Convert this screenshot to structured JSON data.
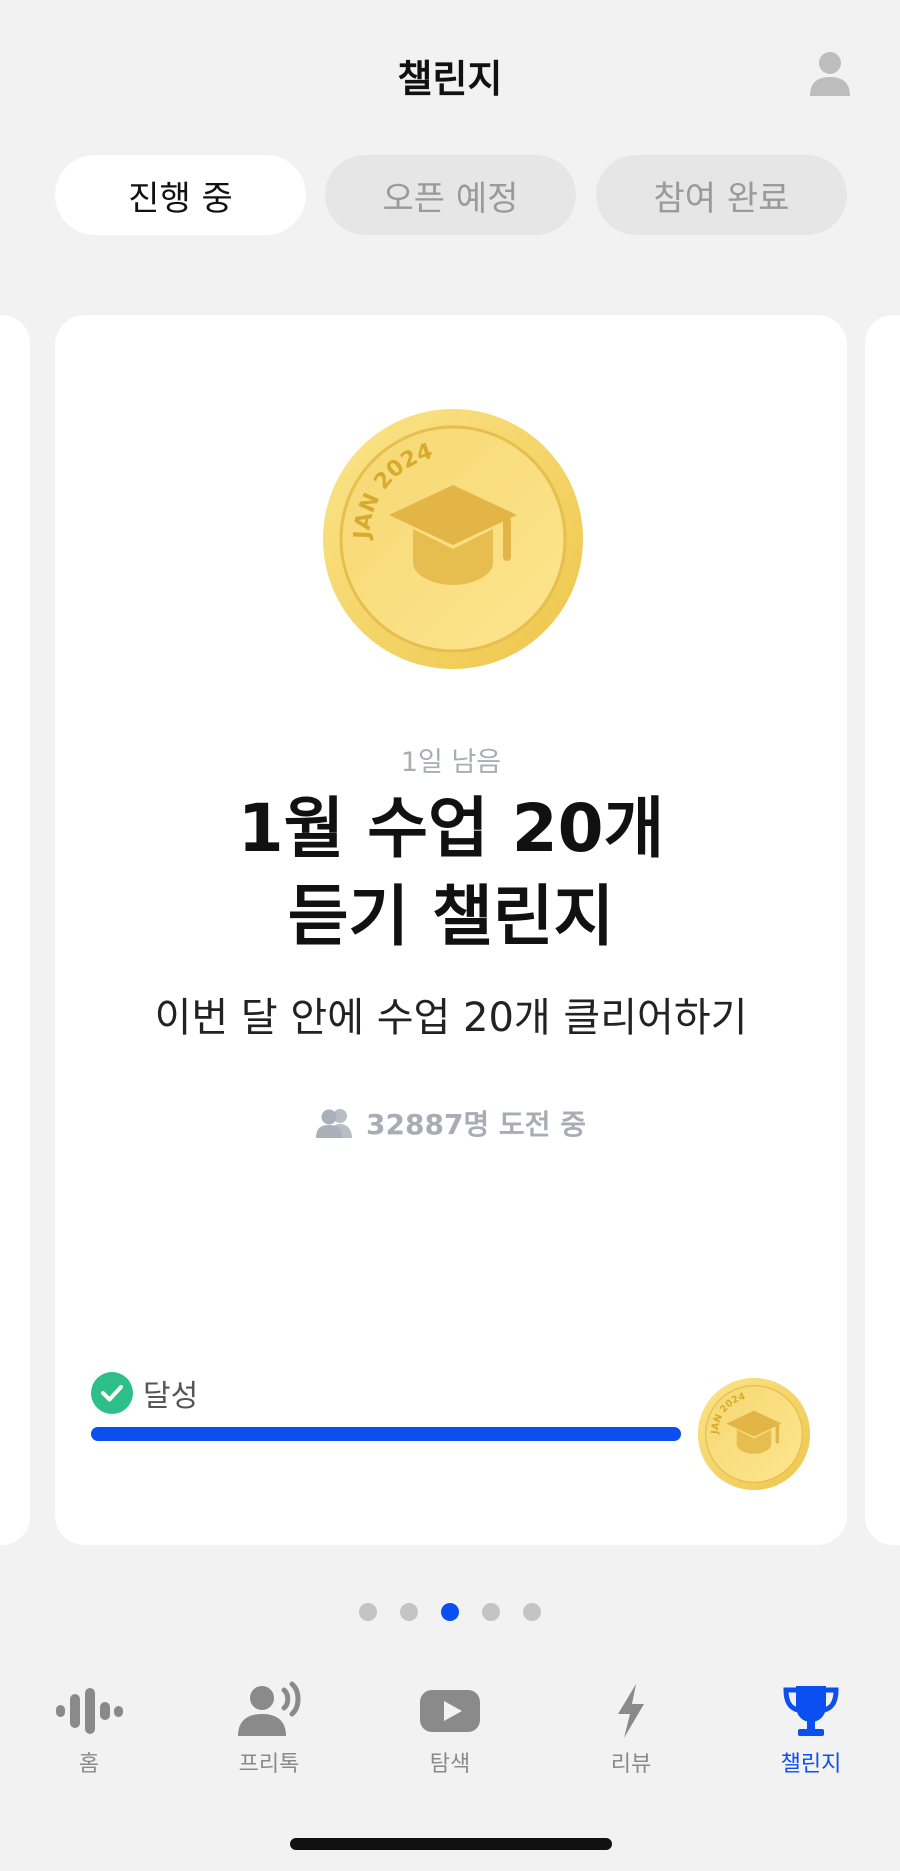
{
  "header": {
    "title": "챌린지",
    "profile_icon": "person-icon"
  },
  "tabs": [
    {
      "label": "진행 중",
      "active": true
    },
    {
      "label": "오픈 예정",
      "active": false
    },
    {
      "label": "참여 완료",
      "active": false
    }
  ],
  "card": {
    "medal_text": "JAN 2024",
    "days_left": "1일 남음",
    "title_line1": "1월 수업 20개",
    "title_line2": "듣기 챌린지",
    "description": "이번 달 안에 수업 20개 클리어하기",
    "participants": "32887명 도전 중",
    "achievement_label": "달성",
    "progress": 1.0
  },
  "pagination": {
    "count": 5,
    "active_index": 2
  },
  "tabbar": [
    {
      "label": "홈",
      "icon": "waveform-icon",
      "active": false
    },
    {
      "label": "프리톡",
      "icon": "speaking-person-icon",
      "active": false
    },
    {
      "label": "탐색",
      "icon": "youtube-icon",
      "active": false
    },
    {
      "label": "리뷰",
      "icon": "lightning-icon",
      "active": false
    },
    {
      "label": "챌린지",
      "icon": "trophy-icon",
      "active": true
    }
  ],
  "colors": {
    "accent": "#0b4ff0",
    "success": "#2dbf8a",
    "gold": "#f3d35f"
  }
}
